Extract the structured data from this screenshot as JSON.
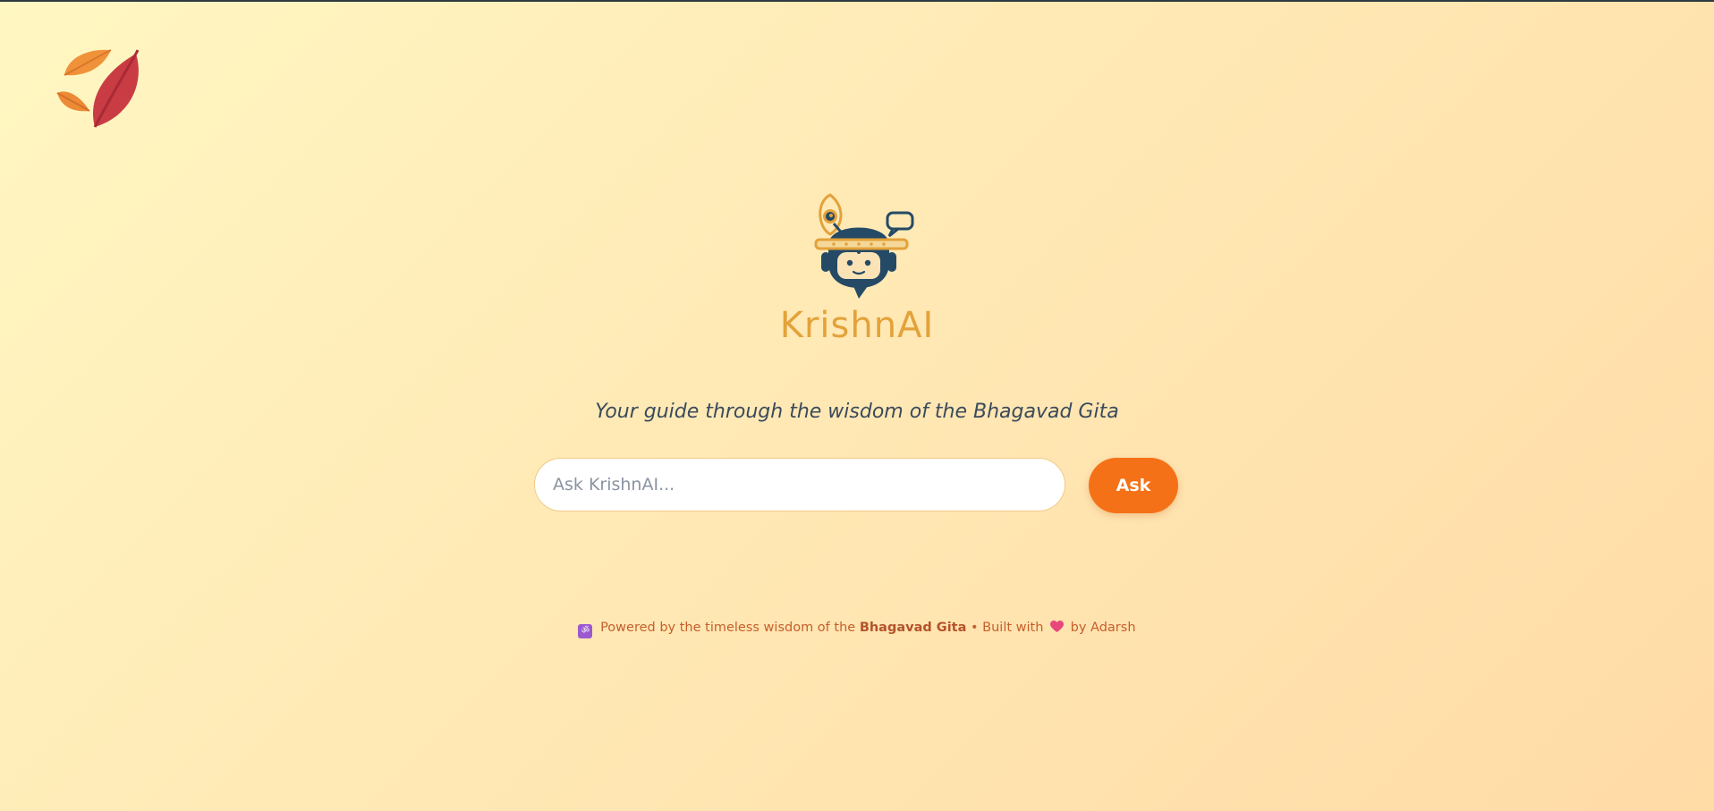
{
  "logo": {
    "icon": "autumn-leaves-icon",
    "colors": [
      "#f0923a",
      "#c93c44",
      "#e46f2b"
    ]
  },
  "hero": {
    "mascot_icon": "krishna-bot-icon",
    "brand": "KrishnAI",
    "brand_color": "#e3a23a"
  },
  "tagline": "Your guide through the wisdom of the Bhagavad Gita",
  "search": {
    "placeholder": "Ask KrishnAI...",
    "value": "",
    "button_label": "Ask",
    "accent": "#f57117"
  },
  "footer": {
    "om_icon": "om-symbol-icon",
    "om_glyph": "ॐ",
    "prefix": "Powered by the timeless wisdom of the",
    "source": "Bhagavad Gita",
    "separator": "•",
    "built_with": "Built with",
    "heart_icon": "heart-icon",
    "suffix": "by Adarsh"
  }
}
